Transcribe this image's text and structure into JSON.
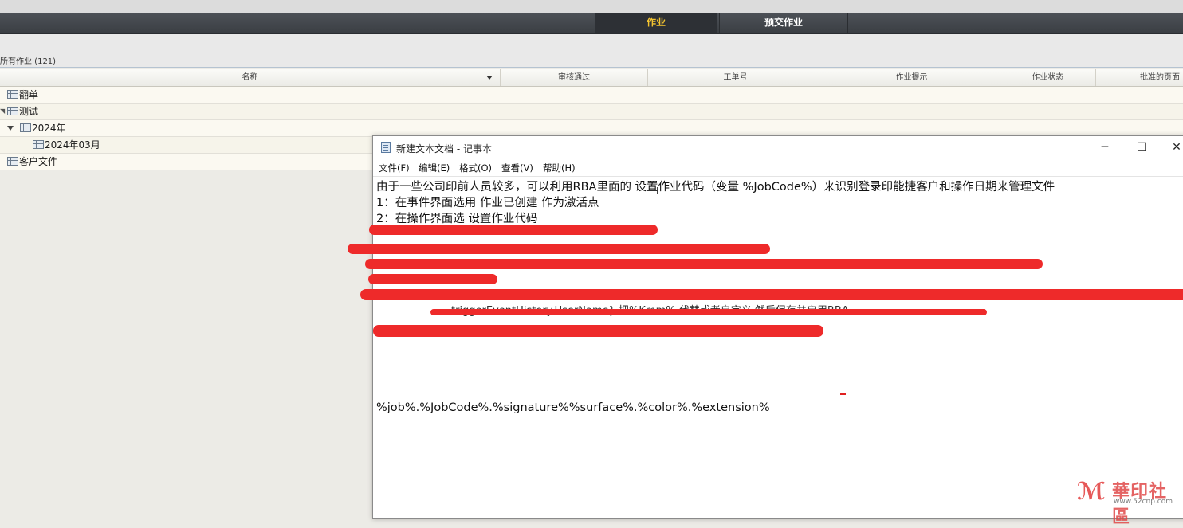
{
  "tabs": [
    {
      "label": "作业",
      "active": true
    },
    {
      "label": "预交作业",
      "active": false
    }
  ],
  "job_count_label": "所有作业 (121)",
  "columns": [
    {
      "label": "名称",
      "sorted": true
    },
    {
      "label": "审核通过"
    },
    {
      "label": "工单号"
    },
    {
      "label": "作业提示"
    },
    {
      "label": "作业状态"
    },
    {
      "label": "批准的页面"
    }
  ],
  "tree": [
    {
      "label": "翻单",
      "level": 0,
      "expanded": false
    },
    {
      "label": "测试",
      "level": 0,
      "expanded": true
    },
    {
      "label": "2024年",
      "level": 1,
      "expanded": true
    },
    {
      "label": "2024年03月",
      "level": 2,
      "expanded": false
    },
    {
      "label": "客户文件",
      "level": 0,
      "expanded": false
    }
  ],
  "notepad": {
    "title": "新建文本文档 - 记事本",
    "menu": [
      "文件(F)",
      "编辑(E)",
      "格式(O)",
      "查看(V)",
      "帮助(H)"
    ],
    "window_buttons": {
      "minimize": "─",
      "maximize": "☐",
      "close": "✕"
    },
    "lines": [
      "由于一些公司印前人员较多，可以利用RBA里面的  设置作业代码（变量 %JobCode%）来识别登录印能捷客户和操作日期来管理文件",
      "1：在事件界面选用  作业已创建 作为激活点",
      "2：在操作界面选 设置作业代码"
    ],
    "obscured_fragment": "triggerEventHistory.UserName}  把%Kmm%  代替或者自定义 然后保存并启用RBA。",
    "template_line": "%job%.%JobCode%.%signature%%surface%.%color%.%extension%",
    "redaction_color": "#ee2a2a"
  },
  "watermark": {
    "text": "華印社區",
    "url": "www.52cnp.com",
    "color": "#e23c3c"
  }
}
